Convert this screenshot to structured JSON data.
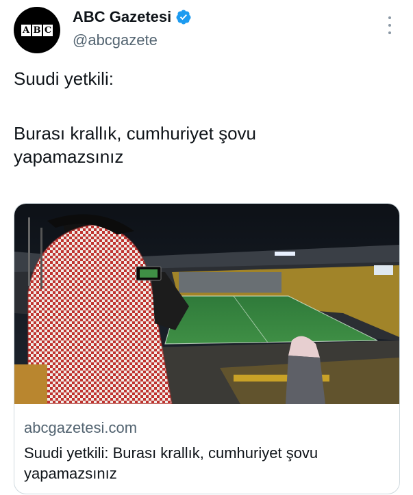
{
  "author": {
    "avatar_letters": [
      "A",
      "B",
      "C"
    ],
    "display_name": "ABC Gazetesi",
    "handle": "@abcgazete",
    "verified_icon": "verified-badge-icon",
    "verified_color": "#1d9bf0"
  },
  "tweet": {
    "line1": "Suudi yetkili:",
    "line2": "Burası krallık, cumhuriyet şovu",
    "line3": "yapamazsınız"
  },
  "link_card": {
    "image_description_icon": "stadium-photo",
    "domain": "abcgazetesi.com",
    "title": "Suudi yetkili: Burası krallık, cumhuriyet şovu yapamazsınız"
  },
  "colors": {
    "text_primary": "#0f1419",
    "text_secondary": "#536471",
    "card_border": "#cfd9de"
  }
}
